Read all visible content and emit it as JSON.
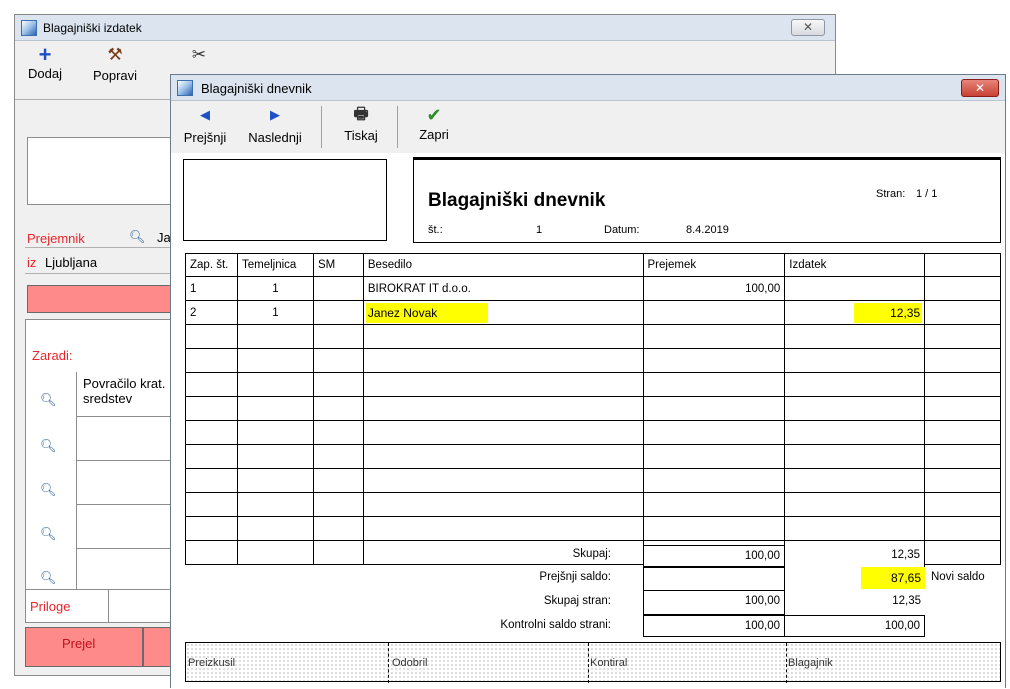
{
  "background_window": {
    "title": "Blagajniški izdatek",
    "close_label": "✕",
    "toolbar": {
      "add_label": "Dodaj",
      "edit_label": "Popravi"
    },
    "fields": {
      "recipient_label": "Prejemnik",
      "recipient_value": "Ja",
      "from_label": "iz",
      "from_value": "Ljubljana",
      "reason_label": "Zaradi:",
      "reason_line1": "Povračilo krat.",
      "reason_line2": "sredstev",
      "attachments_label": "Priloge",
      "received_label": "Prejel"
    }
  },
  "dialog": {
    "title": "Blagajniški dnevnik",
    "close_label": "✕",
    "toolbar": {
      "prev_label": "Prejšnji",
      "next_label": "Naslednji",
      "print_label": "Tiskaj",
      "close_label": "Zapri"
    },
    "report": {
      "title": "Blagajniški dnevnik",
      "page_label": "Stran:",
      "page_value": "1 / 1",
      "number_label": "št.:",
      "number_value": "1",
      "date_label": "Datum:",
      "date_value": "8.4.2019",
      "columns": [
        "Zap. št.",
        "Temeljnica",
        "SM",
        "Besedilo",
        "Prejemek",
        "Izdatek",
        ""
      ],
      "rows": [
        {
          "zap": "1",
          "temeljnica": "1",
          "sm": "",
          "besedilo": "BIROKRAT IT d.o.o.",
          "prejemek": "100,00",
          "izdatek": ""
        },
        {
          "zap": "2",
          "temeljnica": "1",
          "sm": "",
          "besedilo": "Janez Novak",
          "prejemek": "",
          "izdatek": "12,35"
        }
      ],
      "summary": {
        "total_label": "Skupaj:",
        "total_in": "100,00",
        "total_out": "12,35",
        "prev_balance_label": "Prejšnji saldo:",
        "prev_balance_value": "87,65",
        "new_balance_label": "Novi saldo",
        "page_total_label": "Skupaj stran:",
        "page_total_in": "100,00",
        "page_total_out": "12,35",
        "control_label": "Kontrolni saldo strani:",
        "control_in": "100,00",
        "control_out": "100,00"
      },
      "signatures": [
        "Preizkusil",
        "Odobril",
        "Kontiral",
        "Blagajnik"
      ]
    }
  },
  "colors": {
    "highlight": "#ffff00",
    "label_red": "#e8252c",
    "button_pink": "#ff8a8a"
  }
}
